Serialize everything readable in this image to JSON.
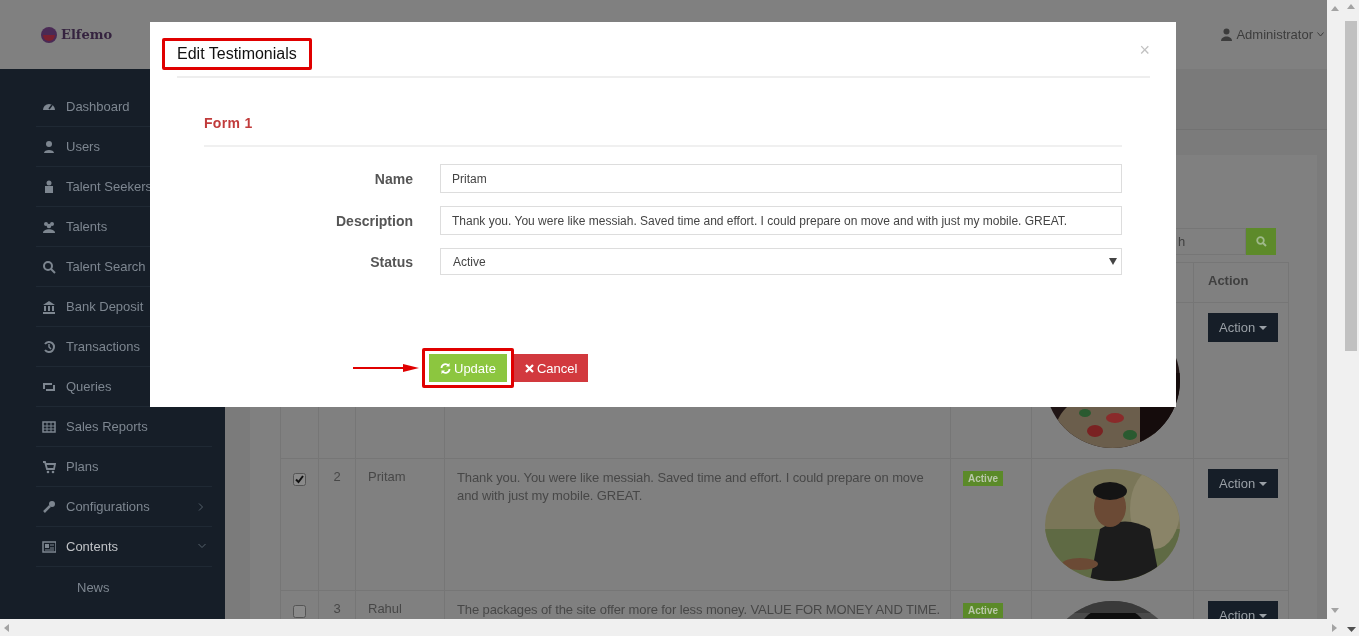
{
  "header": {
    "logo": "Elfemo",
    "user": "Administrator"
  },
  "sidebar": {
    "items": [
      {
        "label": "Dashboard",
        "selected": false
      },
      {
        "label": "Users",
        "selected": false
      },
      {
        "label": "Talent Seekers",
        "selected": false
      },
      {
        "label": "Talents",
        "selected": false
      },
      {
        "label": "Talent Search",
        "selected": false
      },
      {
        "label": "Bank Deposit",
        "selected": false
      },
      {
        "label": "Transactions",
        "selected": false
      },
      {
        "label": "Queries",
        "selected": false
      },
      {
        "label": "Sales Reports",
        "selected": false
      },
      {
        "label": "Plans",
        "selected": false
      },
      {
        "label": "Configurations",
        "selected": false,
        "expanded": false
      },
      {
        "label": "Contents",
        "selected": true,
        "expanded": true,
        "children": [
          {
            "label": "News",
            "selected": false
          }
        ]
      }
    ]
  },
  "search": {
    "placeholder": "h"
  },
  "table": {
    "action_column": "Action",
    "rows": [
      {
        "action": "Action"
      },
      {
        "checked": true,
        "number": "2",
        "name": "Pritam",
        "description": "Thank you. You were like messiah. Saved time and effort. I could prepare on move and with just my mobile. GREAT.",
        "status": "Active",
        "action": "Action"
      },
      {
        "checked": false,
        "number": "3",
        "name": "Rahul",
        "description": "The packages of the site offer more for less money. VALUE FOR MONEY AND TIME.",
        "status": "Active",
        "action": "Action"
      }
    ]
  },
  "modal": {
    "title": "Edit Testimonials",
    "title_highlighted": true,
    "close": "×",
    "section": "Form 1",
    "fields": [
      {
        "label": "Name",
        "kind": "text",
        "value": "Pritam"
      },
      {
        "label": "Description",
        "kind": "text",
        "value": "Thank you. You were like messiah. Saved time and effort. I could prepare on move and with just my mobile. GREAT."
      },
      {
        "label": "Status",
        "kind": "select",
        "value": "Active"
      }
    ],
    "buttons": [
      {
        "label": "Update",
        "kind": "primary",
        "highlighted": true,
        "pointed_at": true
      },
      {
        "label": "Cancel",
        "kind": "danger",
        "highlighted": false,
        "pointed_at": false
      }
    ]
  }
}
